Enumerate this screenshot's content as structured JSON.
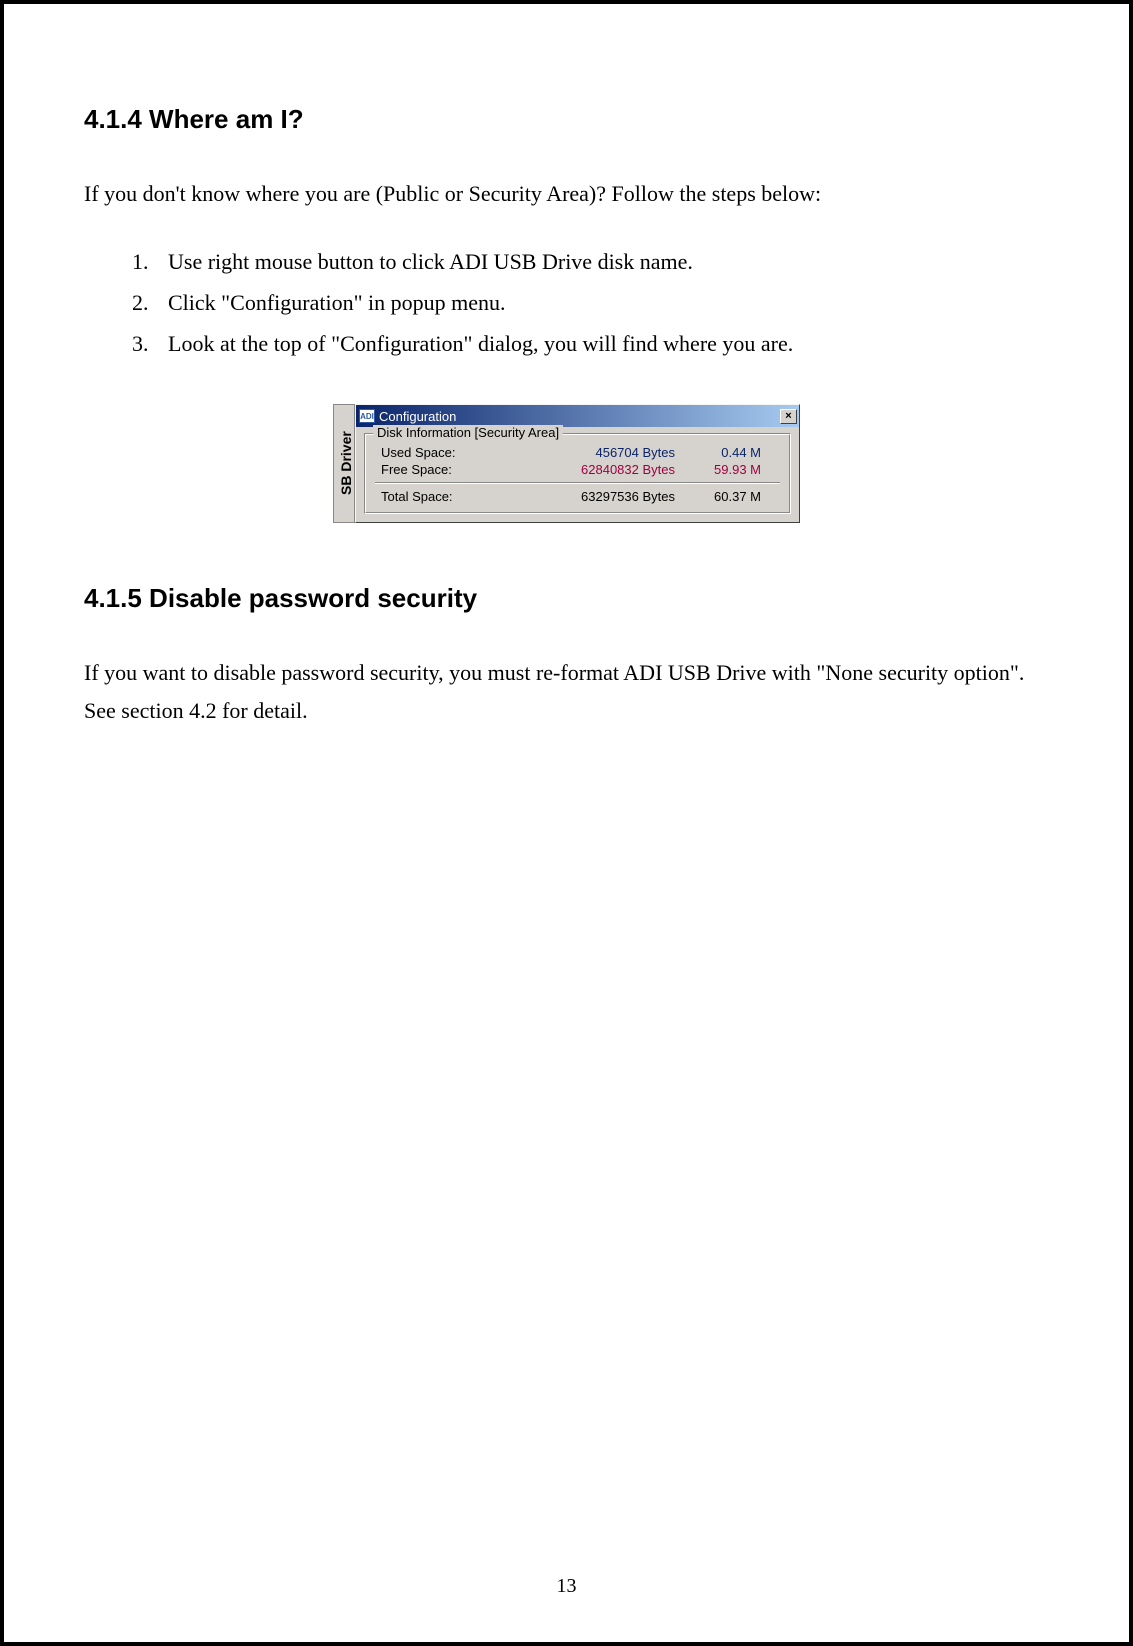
{
  "section1": {
    "heading": "4.1.4 Where am I?",
    "intro": "If you don't know where you are (Public or Security Area)? Follow the steps below:",
    "steps": [
      "Use right mouse button to click ADI USB Drive disk name.",
      "Click \"Configuration\" in popup menu.",
      "Look at the top of \"Configuration\" dialog, you will find where you are."
    ]
  },
  "dialog": {
    "side_tab": "SB Driver",
    "icon_text": "ADI",
    "title": "Configuration",
    "close_label": "×",
    "group_legend": "Disk Information [Security Area]",
    "rows": {
      "used": {
        "label": "Used Space:",
        "bytes": "456704 Bytes",
        "mb": "0.44 M"
      },
      "free": {
        "label": "Free Space:",
        "bytes": "62840832 Bytes",
        "mb": "59.93 M"
      },
      "total": {
        "label": "Total Space:",
        "bytes": "63297536 Bytes",
        "mb": "60.37 M"
      }
    }
  },
  "section2": {
    "heading": "4.1.5 Disable password security",
    "para": "If you want to disable password security, you must re-format ADI USB Drive with \"None security option\". See section 4.2 for detail."
  },
  "page_number": "13"
}
